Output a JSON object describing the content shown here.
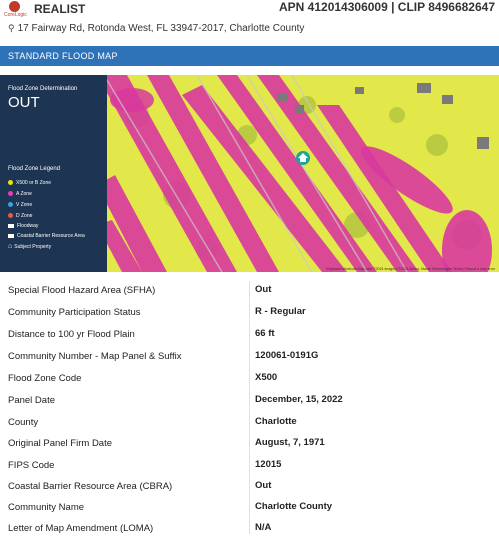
{
  "header": {
    "logo_text": "CoreLogic",
    "brand": "REALIST",
    "apn_clip": "APN 412014306009 | CLIP 8496682647"
  },
  "address": "17 Fairway Rd, Rotonda West, FL 33947-2017, Charlotte County",
  "section_title": "STANDARD FLOOD MAP",
  "map": {
    "determination_label": "Flood Zone Determination",
    "determination_value": "OUT",
    "legend_title": "Flood Zone Legend",
    "legend": [
      {
        "label": "X500 or B Zone",
        "color": "#f2e200",
        "icon": "dot"
      },
      {
        "label": "A Zone",
        "color": "#e83fb0",
        "icon": "dot"
      },
      {
        "label": "V Zone",
        "color": "#3aa3e3",
        "icon": "dot"
      },
      {
        "label": "D Zone",
        "color": "#e85a4a",
        "icon": "dot"
      },
      {
        "label": "Floodway",
        "color": "#ffffff",
        "icon": "square"
      },
      {
        "label": "Coastal Barrier Resource Area",
        "color": "#ffffff",
        "icon": "square"
      },
      {
        "label": "Subject Property",
        "color": "#ffffff",
        "icon": "house-icon"
      }
    ],
    "attribution": "Keyboard shortcuts   Map data ©2024 Imagery ©2024 Airbus, Maxar Technologies   Terms | Report a map error",
    "colors": {
      "zone_x500": "#e8ee3a",
      "zone_a": "#d8389e",
      "panel": "#1d3552",
      "marker": "#1aa79a"
    }
  },
  "details": [
    {
      "label": "Special Flood Hazard Area (SFHA)",
      "value": "Out"
    },
    {
      "label": "Community Participation Status",
      "value": "R - Regular"
    },
    {
      "label": "Distance to 100 yr Flood Plain",
      "value": "66 ft"
    },
    {
      "label": "Community Number - Map Panel & Suffix",
      "value": "120061-0191G"
    },
    {
      "label": "Flood Zone Code",
      "value": "X500"
    },
    {
      "label": "Panel Date",
      "value": "December, 15, 2022"
    },
    {
      "label": "County",
      "value": "Charlotte"
    },
    {
      "label": "Original Panel Firm Date",
      "value": "August, 7, 1971"
    },
    {
      "label": "FIPS Code",
      "value": "12015"
    },
    {
      "label": "Coastal Barrier Resource Area (CBRA)",
      "value": "Out"
    },
    {
      "label": "Community Name",
      "value": "Charlotte County"
    },
    {
      "label": "Letter of Map Amendment (LOMA)",
      "value": "N/A"
    }
  ]
}
